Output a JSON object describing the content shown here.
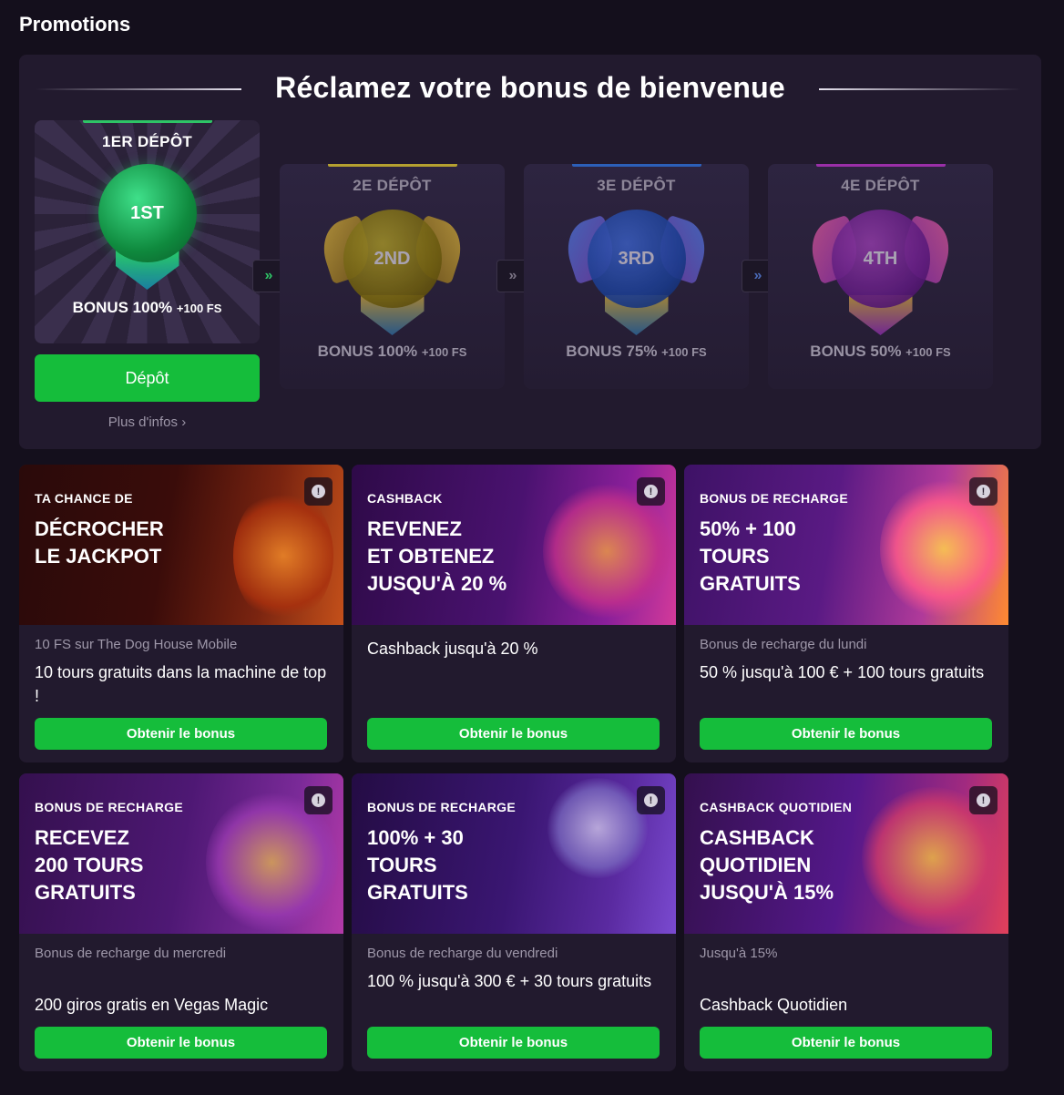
{
  "page": {
    "title": "Promotions"
  },
  "welcome": {
    "heading": "Réclamez votre bonus de bienvenue",
    "deposits": [
      {
        "title": "1ER DÉPÔT",
        "orb": "1ST",
        "bonus": "BONUS 100%",
        "fs": "+100 FS",
        "accent": "#2ec466",
        "active": true
      },
      {
        "title": "2E DÉPÔT",
        "orb": "2ND",
        "bonus": "BONUS 100%",
        "fs": "+100 FS",
        "accent": "#b5a030",
        "active": false
      },
      {
        "title": "3E DÉPÔT",
        "orb": "3RD",
        "bonus": "BONUS 75%",
        "fs": "+100 FS",
        "accent": "#2c5fb8",
        "active": false
      },
      {
        "title": "4E DÉPÔT",
        "orb": "4TH",
        "bonus": "BONUS 50%",
        "fs": "+100 FS",
        "accent": "#9a2fa8",
        "active": false
      }
    ],
    "arrow_icon": "»",
    "deposit_button": "Dépôt",
    "more_link": "Plus d'infos",
    "more_chevron": "›"
  },
  "promos": [
    {
      "tag": "TA CHANCE DE",
      "headline": "DÉCROCHER\nLE JACKPOT",
      "subtitle": "10 FS sur The Dog House Mobile",
      "description": "10 tours gratuits dans la machine de top !",
      "button": "Obtenir le bonus",
      "theme": [
        "#2a0a0a",
        "#7a2410",
        "#e66b14"
      ]
    },
    {
      "tag": "CASHBACK",
      "headline": "REVENEZ\nET OBTENEZ\nJUSQU'À 20 %",
      "subtitle": "",
      "description": "Cashback jusqu'à 20 %",
      "button": "Obtenir le bonus",
      "theme": [
        "#3a0c4e",
        "#6a1a8a",
        "#e23aa0"
      ]
    },
    {
      "tag": "BONUS DE RECHARGE",
      "headline": "50% + 100\nTOURS\nGRATUITS",
      "subtitle": "Bonus de recharge du lundi",
      "description": "50 % jusqu'à 100 € + 100 tours gratuits",
      "button": "Obtenir le bonus",
      "theme": [
        "#4a1470",
        "#8a2a9a",
        "#ff7a2a"
      ]
    },
    {
      "tag": "BONUS DE RECHARGE",
      "headline": "RECEVEZ\n200 TOURS\nGRATUITS",
      "subtitle": "Bonus de recharge du mercredi",
      "description": "200 giros gratis en Vegas Magic",
      "button": "Obtenir le bonus",
      "theme": [
        "#3a0f5a",
        "#6a2290",
        "#c43ab0"
      ]
    },
    {
      "tag": "BONUS DE RECHARGE",
      "headline": "100% + 30\nTOURS\nGRATUITS",
      "subtitle": "Bonus de recharge du vendredi",
      "description": "100 % jusqu'à 300 € + 30 tours gratuits",
      "button": "Obtenir le bonus",
      "theme": [
        "#2a0f4a",
        "#4a1a80",
        "#8a5ae0"
      ]
    },
    {
      "tag": "CASHBACK QUOTIDIEN",
      "headline": "CASHBACK\nQUOTIDIEN\nJUSQU'À 15%",
      "subtitle": "Jusqu'à 15%",
      "description": "Cashback Quotidien",
      "button": "Obtenir le bonus",
      "theme": [
        "#3a0f5a",
        "#7a2aa0",
        "#e23a6a"
      ]
    }
  ]
}
